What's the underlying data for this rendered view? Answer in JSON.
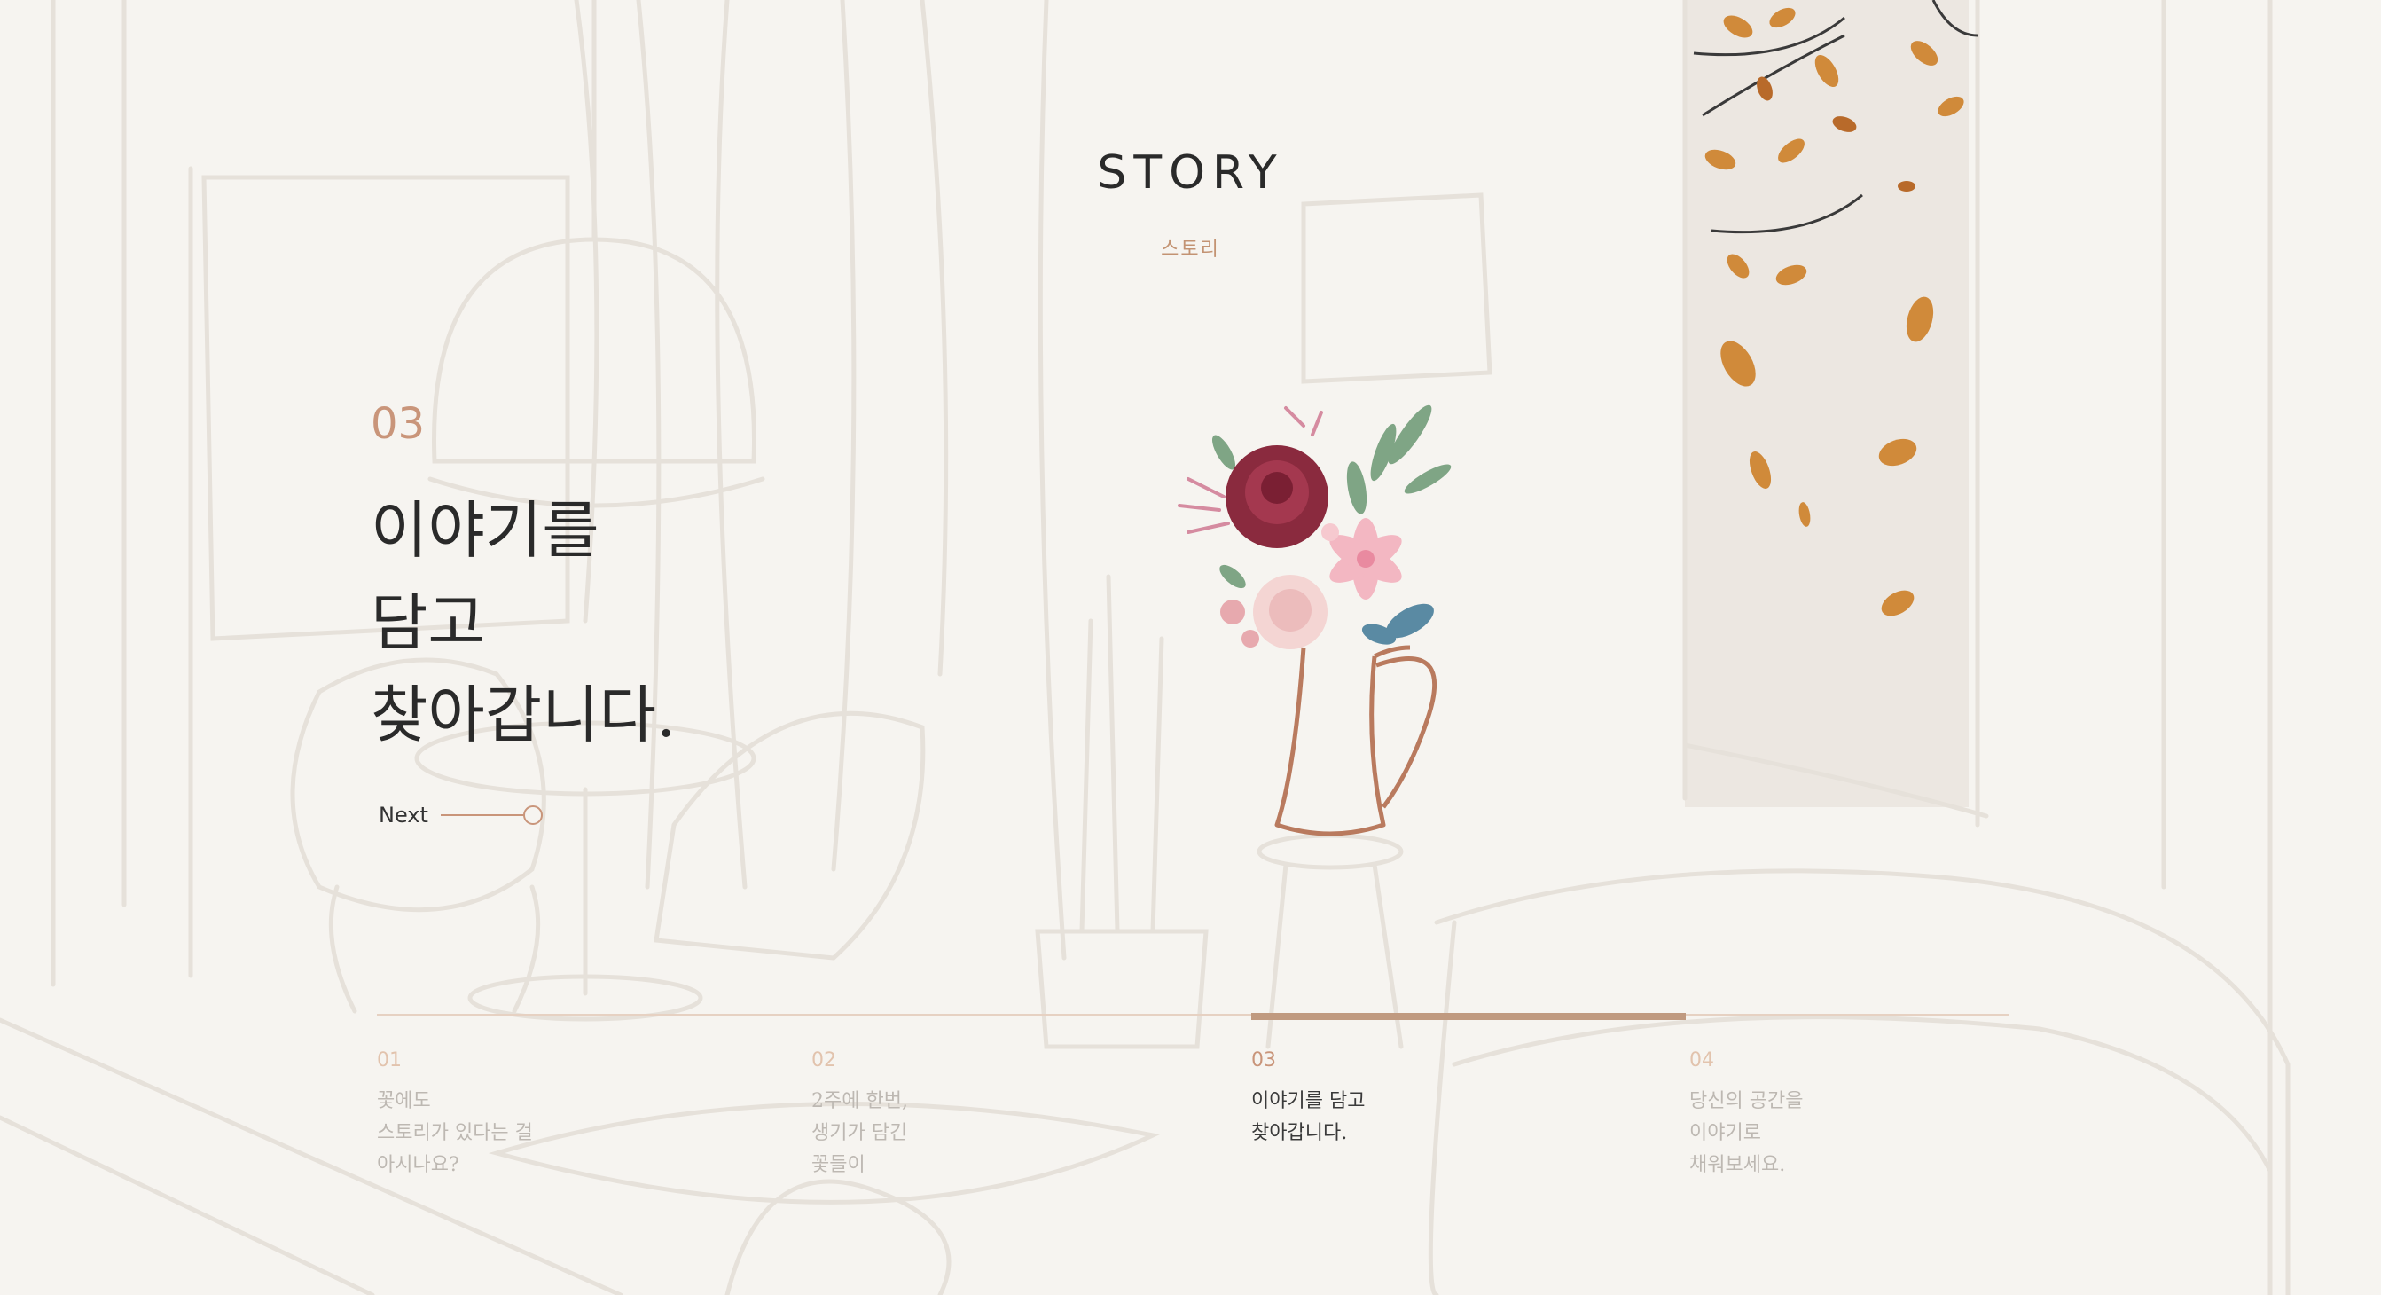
{
  "header": {
    "title": "STORY",
    "subtitle": "스토리"
  },
  "hero": {
    "number": "03",
    "headline_lines": [
      "이야기를",
      "담고",
      "찾아갑니다."
    ],
    "next_label": "Next"
  },
  "progress": {
    "active_index": 2,
    "total": 4
  },
  "steps": [
    {
      "number": "01",
      "lines": [
        "꽃에도",
        "스토리가 있다는 걸",
        "아시나요?"
      ]
    },
    {
      "number": "02",
      "lines": [
        "2주에 한번,",
        "생기가 담긴",
        "꽃들이"
      ]
    },
    {
      "number": "03",
      "lines": [
        "이야기를 담고",
        "찾아갑니다."
      ]
    },
    {
      "number": "04",
      "lines": [
        "당신의 공간을",
        "이야기로",
        "채워보세요."
      ]
    }
  ],
  "colors": {
    "accent": "#c9957a",
    "accent_bar": "#c09a80",
    "background": "#f6f4f0",
    "text_dark": "#2a2a2a",
    "text_muted": "#bdb8b2"
  },
  "icons": [
    "next-circle-icon",
    "vase-icon",
    "bouquet-icon",
    "autumn-leaves-icon",
    "room-sketch"
  ]
}
